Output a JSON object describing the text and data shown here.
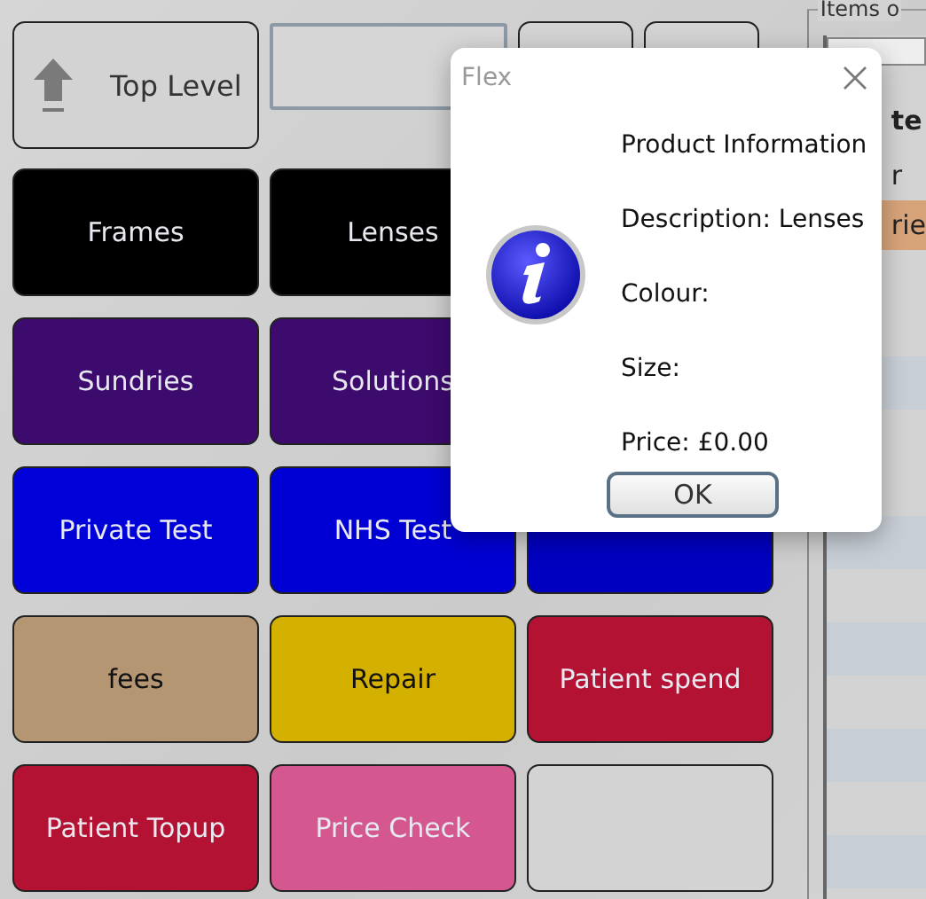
{
  "top_row": {
    "top_level_button": "Top Level"
  },
  "categories": [
    {
      "kind": "button",
      "label": "Frames",
      "color": "#000000"
    },
    {
      "kind": "button",
      "label": "Lenses",
      "color": "#000000"
    },
    {
      "kind": "hidden"
    },
    {
      "kind": "button",
      "label": "Sundries",
      "color": "#3d0a6e"
    },
    {
      "kind": "button",
      "label": "Solutions",
      "color": "#3d0a6e"
    },
    {
      "kind": "hidden"
    },
    {
      "kind": "button",
      "label": "Private Test",
      "color": "#0000d8"
    },
    {
      "kind": "button",
      "label": "NHS Test",
      "color": "#0000d4"
    },
    {
      "kind": "button",
      "color": "#0000c0"
    },
    {
      "kind": "button",
      "label": "fees",
      "color": "#b59673"
    },
    {
      "kind": "button",
      "label": "Repair",
      "color": "#d4b000"
    },
    {
      "kind": "button",
      "label": "Patient spend",
      "color": "#b31232"
    },
    {
      "kind": "button",
      "label": "Patient  Topup",
      "color": "#b31232"
    },
    {
      "kind": "button",
      "label": "Price Check",
      "color": "#d4588f"
    },
    {
      "kind": "button",
      "color": "#d3d3d3"
    }
  ],
  "items_panel": {
    "title": "Items o",
    "rows": [
      {
        "text": "te",
        "kind": "header"
      },
      {
        "text": "r",
        "kind": "plain"
      },
      {
        "text": "rie",
        "kind": "highlight"
      }
    ]
  },
  "dialog": {
    "title": "Flex",
    "lines": [
      "Product Information",
      "Description: Lenses",
      "Colour:",
      "Size:",
      "Price: £0.00"
    ],
    "button": "OK"
  }
}
